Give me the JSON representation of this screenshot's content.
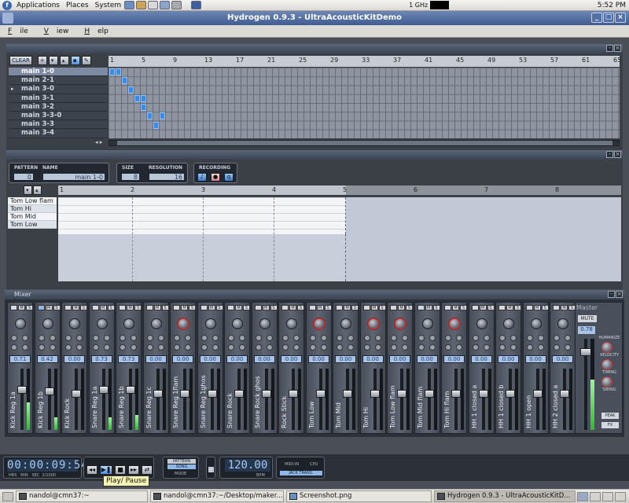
{
  "top_panel": {
    "menus": [
      "Applications",
      "Places",
      "System"
    ],
    "cpu_freq": "1 GHz",
    "clock": "5:52 PM"
  },
  "window": {
    "title": "Hydrogen 0.9.3 - UltraAcousticKitDemo",
    "menus": [
      {
        "label": "File",
        "underline": "F",
        "rest": "ile"
      },
      {
        "label": "View",
        "underline": "V",
        "rest": "iew"
      },
      {
        "label": "Help",
        "underline": "H",
        "rest": "elp"
      }
    ]
  },
  "song_editor": {
    "clear_label": "CLEAR",
    "ruler_numbers": [
      "1",
      "5",
      "9",
      "13",
      "17",
      "21",
      "25",
      "29",
      "33",
      "37",
      "41",
      "45",
      "49",
      "53",
      "57",
      "61",
      "65"
    ],
    "patterns": [
      "main 1-0",
      "main 2-1",
      "main 3-0",
      "main 3-1",
      "main 3-2",
      "main 3-3-0",
      "main 3-3",
      "main 3-4"
    ],
    "selected_pattern_index": 0,
    "cells": [
      [
        0,
        0
      ],
      [
        0,
        1
      ],
      [
        1,
        2
      ],
      [
        2,
        3
      ],
      [
        3,
        4
      ],
      [
        4,
        5
      ],
      [
        3,
        5
      ],
      [
        5,
        6
      ],
      [
        6,
        7
      ],
      [
        5,
        8
      ]
    ]
  },
  "pattern_editor": {
    "pattern_label": "PATTERN",
    "name_label": "NAME",
    "pattern_number": "0",
    "pattern_name": "main 1-0",
    "size_label": "SIZE",
    "size_value": "8",
    "resolution_label": "RESOLUTION",
    "resolution_value": "16",
    "recording_label": "RECORDING",
    "ruler_numbers": [
      "1",
      "2",
      "3",
      "4",
      "5",
      "6",
      "7",
      "8"
    ],
    "instruments": [
      "Tom Low flam",
      "Tom Hi",
      "Tom Mid",
      "Tom Low"
    ]
  },
  "mixer": {
    "title": "Mixer",
    "channels": [
      {
        "name": "Kick Reg 1a",
        "db": "0.71",
        "fader": 0.68,
        "level": 0.45,
        "red": false
      },
      {
        "name": "Kick Reg 1b",
        "db": "0.42",
        "fader": 0.65,
        "level": 0.2,
        "red": false
      },
      {
        "name": "Kick Rock",
        "db": "0.00",
        "fader": 0.6,
        "level": 0.0,
        "red": false
      },
      {
        "name": "Snare Reg 1a",
        "db": "0.73",
        "fader": 0.68,
        "level": 0.2,
        "red": false
      },
      {
        "name": "Snare Reg 1b",
        "db": "0.73",
        "fader": 0.68,
        "level": 0.25,
        "red": false
      },
      {
        "name": "Snare Reg 1c",
        "db": "0.00",
        "fader": 0.6,
        "level": 0.0,
        "red": false
      },
      {
        "name": "Snare Reg 1flam",
        "db": "0.00",
        "fader": 0.6,
        "level": 0.0,
        "red": true
      },
      {
        "name": "Snare Reg 1ghos",
        "db": "0.00",
        "fader": 0.6,
        "level": 0.0,
        "red": false
      },
      {
        "name": "Snare Rock",
        "db": "0.00",
        "fader": 0.6,
        "level": 0.0,
        "red": false
      },
      {
        "name": "Snare Rock ghos",
        "db": "0.00",
        "fader": 0.6,
        "level": 0.0,
        "red": false
      },
      {
        "name": "Rock Stick",
        "db": "0.00",
        "fader": 0.6,
        "level": 0.0,
        "red": false
      },
      {
        "name": "Tom Low",
        "db": "0.00",
        "fader": 0.6,
        "level": 0.0,
        "red": true
      },
      {
        "name": "Tom Mid",
        "db": "0.00",
        "fader": 0.6,
        "level": 0.0,
        "red": false
      },
      {
        "name": "Tom Hi",
        "db": "0.00",
        "fader": 0.6,
        "level": 0.0,
        "red": true
      },
      {
        "name": "Tom Low flam",
        "db": "0.00",
        "fader": 0.6,
        "level": 0.0,
        "red": true
      },
      {
        "name": "Tom Mid flam",
        "db": "0.00",
        "fader": 0.6,
        "level": 0.0,
        "red": false
      },
      {
        "name": "Tom Hi flam",
        "db": "0.00",
        "fader": 0.6,
        "level": 0.0,
        "red": true
      },
      {
        "name": "HH 1 closed a",
        "db": "0.00",
        "fader": 0.6,
        "level": 0.0,
        "red": false
      },
      {
        "name": "HH 1 closed b",
        "db": "0.00",
        "fader": 0.6,
        "level": 0.0,
        "red": false
      },
      {
        "name": "HH 1 open",
        "db": "0.00",
        "fader": 0.6,
        "level": 0.0,
        "red": false
      },
      {
        "name": "HH 2 closed a",
        "db": "0.00",
        "fader": 0.6,
        "level": 0.0,
        "red": false
      }
    ],
    "master": {
      "label": "Master",
      "mute": "MUTE",
      "db": "0.78",
      "level": 0.55,
      "humanize": "HUMANIZE",
      "velocity": "VELOCITY",
      "timing": "TIMING",
      "swing": "SWING",
      "peak": "PEAK",
      "fx": "FX"
    }
  },
  "transport": {
    "time": "00:00:09:543",
    "time_labels": "HRS   MIN   SEC  1/1000",
    "pattern_mode": "PATTERN",
    "song_mode": "SONG",
    "mode_label": "MODE",
    "bpm": "120.00",
    "bpm_label": "BPM",
    "midi_in": "MIDI-IN",
    "cpu": "CPU",
    "jack_trans": "JACK TRANS."
  },
  "tooltip": "Play/ Pause",
  "taskbar": {
    "items": [
      {
        "label": "nandol@cmn37:~",
        "active": false
      },
      {
        "label": "nandol@cmn37:~/Desktop/maker...",
        "active": false
      },
      {
        "label": "Screenshot.png",
        "active": false
      },
      {
        "label": "Hydrogen 0.9.3 - UltraAcousticKitD...",
        "active": true
      }
    ]
  }
}
